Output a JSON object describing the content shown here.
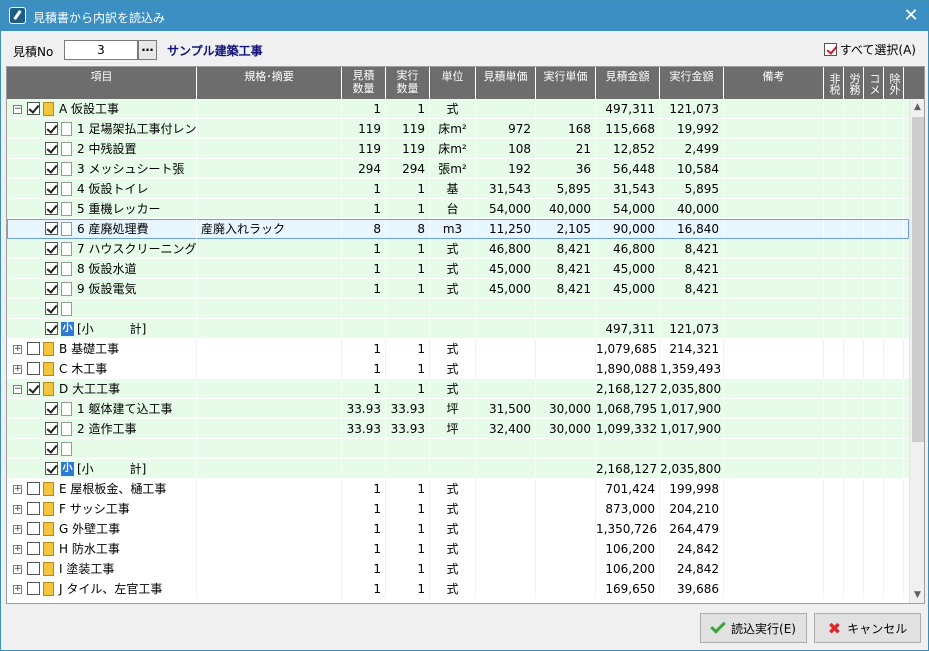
{
  "window": {
    "title": "見積書から内訳を読込み",
    "close": "✕"
  },
  "toolbar": {
    "no_label": "見積No",
    "no_value": "3",
    "no_btn": "…",
    "project": "サンプル建築工事",
    "select_all": "すべて選択(A)"
  },
  "columns": [
    {
      "label": "項目",
      "w": 190
    },
    {
      "label": "規格･摘要",
      "w": 145
    },
    {
      "label": "見積\n数量",
      "w": 44
    },
    {
      "label": "実行\n数量",
      "w": 44
    },
    {
      "label": "単位",
      "w": 46
    },
    {
      "label": "見積単価",
      "w": 60
    },
    {
      "label": "実行単価",
      "w": 60
    },
    {
      "label": "見積金額",
      "w": 64
    },
    {
      "label": "実行金額",
      "w": 64
    },
    {
      "label": "備考",
      "w": 100
    },
    {
      "label": "非税",
      "w": 20,
      "v": true
    },
    {
      "label": "労務",
      "w": 20,
      "v": true
    },
    {
      "label": "コメ",
      "w": 20,
      "v": true
    },
    {
      "label": "除外",
      "w": 20,
      "v": true
    }
  ],
  "rows": [
    {
      "lv": 0,
      "exp": "−",
      "chk": true,
      "ic": "f",
      "code": "A",
      "name": "仮設工事",
      "mq": "1",
      "jq": "1",
      "u": "式",
      "mp": "",
      "jp": "",
      "ma": "497,311",
      "ja": "121,073",
      "bg": "green"
    },
    {
      "lv": 1,
      "chk": true,
      "ic": "b",
      "code": "1",
      "name": "足場架払工事付レン",
      "mq": "119",
      "jq": "119",
      "u": "床m²",
      "mp": "972",
      "jp": "168",
      "ma": "115,668",
      "ja": "19,992",
      "bg": "green"
    },
    {
      "lv": 1,
      "chk": true,
      "ic": "b",
      "code": "2",
      "name": "中残設置",
      "mq": "119",
      "jq": "119",
      "u": "床m²",
      "mp": "108",
      "jp": "21",
      "ma": "12,852",
      "ja": "2,499",
      "bg": "green"
    },
    {
      "lv": 1,
      "chk": true,
      "ic": "b",
      "code": "3",
      "name": "メッシュシート張",
      "mq": "294",
      "jq": "294",
      "u": "張m²",
      "mp": "192",
      "jp": "36",
      "ma": "56,448",
      "ja": "10,584",
      "bg": "green"
    },
    {
      "lv": 1,
      "chk": true,
      "ic": "b",
      "code": "4",
      "name": "仮設トイレ",
      "mq": "1",
      "jq": "1",
      "u": "基",
      "mp": "31,543",
      "jp": "5,895",
      "ma": "31,543",
      "ja": "5,895",
      "bg": "green"
    },
    {
      "lv": 1,
      "chk": true,
      "ic": "b",
      "code": "5",
      "name": "重機レッカー",
      "mq": "1",
      "jq": "1",
      "u": "台",
      "mp": "54,000",
      "jp": "40,000",
      "ma": "54,000",
      "ja": "40,000",
      "bg": "green"
    },
    {
      "lv": 1,
      "chk": true,
      "ic": "b",
      "code": "6",
      "name": "産廃処理費",
      "spec": "産廃入れラック",
      "mq": "8",
      "jq": "8",
      "u": "m3",
      "mp": "11,250",
      "jp": "2,105",
      "ma": "90,000",
      "ja": "16,840",
      "bg": "sel"
    },
    {
      "lv": 1,
      "chk": true,
      "ic": "b",
      "code": "7",
      "name": "ハウスクリーニング",
      "mq": "1",
      "jq": "1",
      "u": "式",
      "mp": "46,800",
      "jp": "8,421",
      "ma": "46,800",
      "ja": "8,421",
      "bg": "green"
    },
    {
      "lv": 1,
      "chk": true,
      "ic": "b",
      "code": "8",
      "name": "仮設水道",
      "mq": "1",
      "jq": "1",
      "u": "式",
      "mp": "45,000",
      "jp": "8,421",
      "ma": "45,000",
      "ja": "8,421",
      "bg": "green"
    },
    {
      "lv": 1,
      "chk": true,
      "ic": "b",
      "code": "9",
      "name": "仮設電気",
      "mq": "1",
      "jq": "1",
      "u": "式",
      "mp": "45,000",
      "jp": "8,421",
      "ma": "45,000",
      "ja": "8,421",
      "bg": "green"
    },
    {
      "lv": 1,
      "chk": true,
      "ic": "b",
      "code": "",
      "name": "",
      "bg": "green"
    },
    {
      "lv": 1,
      "chk": true,
      "ic": "s",
      "code": "",
      "name": "[小　　　計]",
      "ma": "497,311",
      "ja": "121,073",
      "bg": "green"
    },
    {
      "lv": 0,
      "exp": "+",
      "chk": false,
      "ic": "f",
      "code": "B",
      "name": "基礎工事",
      "mq": "1",
      "jq": "1",
      "u": "式",
      "ma": "1,079,685",
      "ja": "214,321",
      "bg": "white"
    },
    {
      "lv": 0,
      "exp": "+",
      "chk": false,
      "ic": "f",
      "code": "C",
      "name": "木工事",
      "mq": "1",
      "jq": "1",
      "u": "式",
      "ma": "1,890,088",
      "ja": "1,359,493",
      "bg": "white"
    },
    {
      "lv": 0,
      "exp": "−",
      "chk": true,
      "ic": "f",
      "code": "D",
      "name": "大工工事",
      "mq": "1",
      "jq": "1",
      "u": "式",
      "ma": "2,168,127",
      "ja": "2,035,800",
      "bg": "green"
    },
    {
      "lv": 1,
      "chk": true,
      "ic": "b",
      "code": "1",
      "name": "躯体建て込工事",
      "mq": "33.93",
      "jq": "33.93",
      "u": "坪",
      "mp": "31,500",
      "jp": "30,000",
      "ma": "1,068,795",
      "ja": "1,017,900",
      "bg": "green"
    },
    {
      "lv": 1,
      "chk": true,
      "ic": "b",
      "code": "2",
      "name": "造作工事",
      "mq": "33.93",
      "jq": "33.93",
      "u": "坪",
      "mp": "32,400",
      "jp": "30,000",
      "ma": "1,099,332",
      "ja": "1,017,900",
      "bg": "green"
    },
    {
      "lv": 1,
      "chk": true,
      "ic": "b",
      "code": "",
      "name": "",
      "bg": "green"
    },
    {
      "lv": 1,
      "chk": true,
      "ic": "s",
      "code": "",
      "name": "[小　　　計]",
      "ma": "2,168,127",
      "ja": "2,035,800",
      "bg": "green"
    },
    {
      "lv": 0,
      "exp": "+",
      "chk": false,
      "ic": "f",
      "code": "E",
      "name": "屋根板金、樋工事",
      "mq": "1",
      "jq": "1",
      "u": "式",
      "ma": "701,424",
      "ja": "199,998",
      "bg": "white"
    },
    {
      "lv": 0,
      "exp": "+",
      "chk": false,
      "ic": "f",
      "code": "F",
      "name": "サッシ工事",
      "mq": "1",
      "jq": "1",
      "u": "式",
      "ma": "873,000",
      "ja": "204,210",
      "bg": "white"
    },
    {
      "lv": 0,
      "exp": "+",
      "chk": false,
      "ic": "f",
      "code": "G",
      "name": "外壁工事",
      "mq": "1",
      "jq": "1",
      "u": "式",
      "ma": "1,350,726",
      "ja": "264,479",
      "bg": "white"
    },
    {
      "lv": 0,
      "exp": "+",
      "chk": false,
      "ic": "f",
      "code": "H",
      "name": "防水工事",
      "mq": "1",
      "jq": "1",
      "u": "式",
      "ma": "106,200",
      "ja": "24,842",
      "bg": "white"
    },
    {
      "lv": 0,
      "exp": "+",
      "chk": false,
      "ic": "f",
      "code": "I",
      "name": "塗装工事",
      "mq": "1",
      "jq": "1",
      "u": "式",
      "ma": "106,200",
      "ja": "24,842",
      "bg": "white"
    },
    {
      "lv": 0,
      "exp": "+",
      "chk": false,
      "ic": "f",
      "code": "J",
      "name": "タイル、左官工事",
      "mq": "1",
      "jq": "1",
      "u": "式",
      "ma": "169,650",
      "ja": "39,686",
      "bg": "white"
    }
  ],
  "buttons": {
    "exec": "読込実行(E)",
    "cancel": "キャンセル"
  }
}
